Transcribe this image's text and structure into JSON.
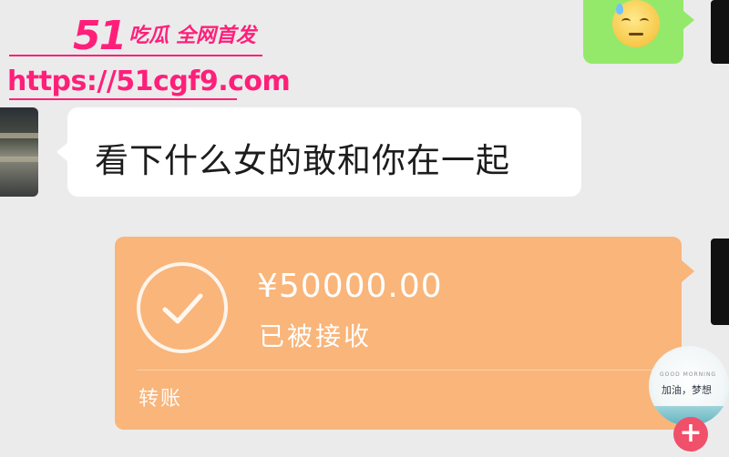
{
  "watermark": {
    "brand_num": "51",
    "brand_text": "吃瓜 全网首发",
    "url": "https://51cgf9.com",
    "color": "#ff1f7a"
  },
  "chat": {
    "incoming_message": "看下什么女的敢和你在一起",
    "transfer": {
      "amount": "¥50000.00",
      "status": "已被接收",
      "label": "转账",
      "color": "#f9b57a"
    },
    "my_bubble_color": "#95e96a"
  },
  "sticker": {
    "tiny_text": "GOOD MORNING",
    "text": "加油，梦想"
  },
  "icons": {
    "check": "check-icon",
    "add": "plus-icon",
    "emoji": "sweat-emoji-icon"
  },
  "add_symbol": "+"
}
